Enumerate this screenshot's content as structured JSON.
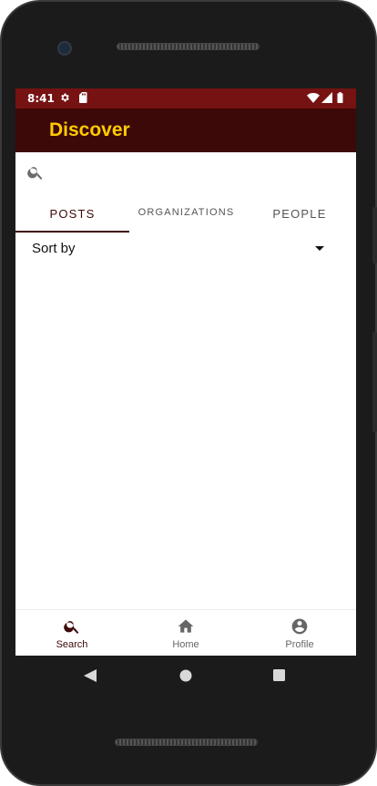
{
  "status_bar": {
    "time": "8:41",
    "icons": [
      "gear-icon",
      "sd-card-icon",
      "wifi-icon",
      "signal-icon",
      "battery-icon"
    ]
  },
  "app_bar": {
    "title": "Discover"
  },
  "search": {
    "value": "",
    "placeholder": "",
    "icon": "search-icon"
  },
  "tabs": [
    {
      "label": "POSTS",
      "active": true
    },
    {
      "label": "ORGANIZATIONS",
      "active": false
    },
    {
      "label": "PEOPLE",
      "active": false
    }
  ],
  "sort": {
    "label": "Sort by"
  },
  "bottom_nav": {
    "items": [
      {
        "label": "Search",
        "icon": "search-icon",
        "active": true
      },
      {
        "label": "Home",
        "icon": "home-icon",
        "active": false
      },
      {
        "label": "Profile",
        "icon": "profile-icon",
        "active": false
      }
    ]
  },
  "system_nav": {
    "icons": [
      "back-icon",
      "home-circle-icon",
      "recents-icon"
    ]
  },
  "colors": {
    "status_bar": "#771212",
    "app_bar": "#3d0808",
    "title": "#ffcc00",
    "active_tab": "#3d0808",
    "inactive": "#666666"
  }
}
